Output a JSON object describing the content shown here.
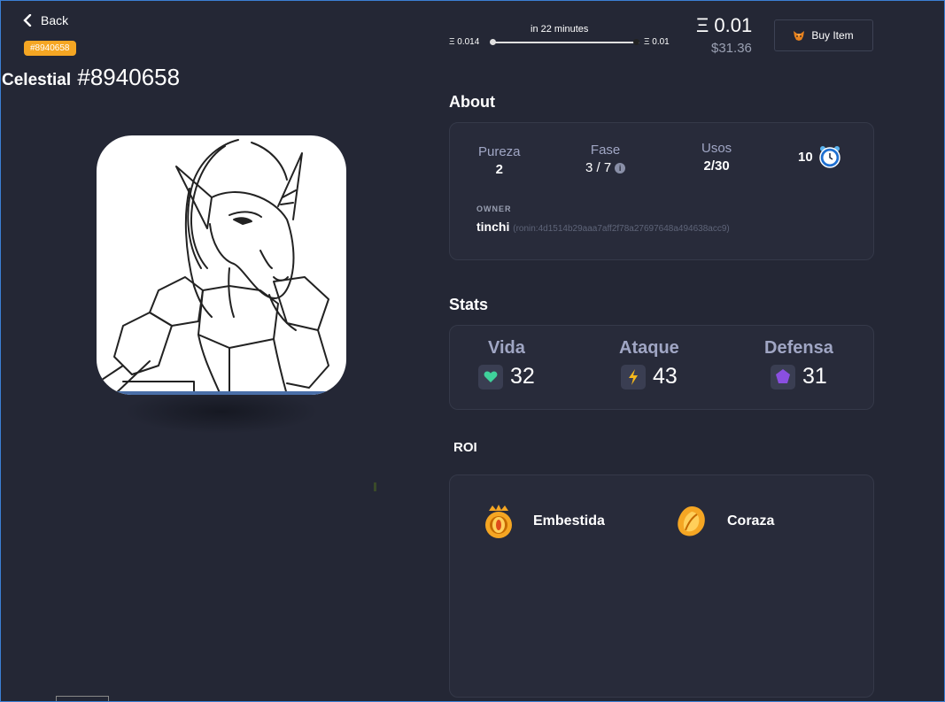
{
  "nav": {
    "back_label": "Back"
  },
  "axie": {
    "id_badge": "#8940658",
    "class_name": "Celestial",
    "number": "#8940658"
  },
  "price": {
    "time_label": "in 22 minutes",
    "start_price": "Ξ 0.014",
    "end_price": "Ξ 0.01",
    "current_eth": "Ξ 0.01",
    "current_usd": "$31.36"
  },
  "buy": {
    "label": "Buy Item"
  },
  "about": {
    "title": "About",
    "pureza_label": "Pureza",
    "pureza_value": "2",
    "fase_label": "Fase",
    "fase_value": "3 / 7",
    "usos_label": "Usos",
    "usos_value": "2/30",
    "energy_value": "10",
    "owner_label": "OWNER",
    "owner_name": "tinchi",
    "owner_address": "(ronin:4d1514b29aaa7aff2f78a27697648a494638acc9)"
  },
  "stats": {
    "title": "Stats",
    "vida_label": "Vida",
    "vida_value": "32",
    "ataque_label": "Ataque",
    "ataque_value": "43",
    "defensa_label": "Defensa",
    "defensa_value": "31"
  },
  "roi": {
    "title": "ROI",
    "cards": [
      {
        "name": "Embestida"
      },
      {
        "name": "Coraza"
      }
    ]
  },
  "colors": {
    "background": "#242735",
    "card": "#282b3a",
    "badge": "#f5a623",
    "label": "#a0a6c4",
    "heart": "#3fd19b",
    "bolt": "#f5b81c",
    "shield": "#8a4fe0"
  }
}
